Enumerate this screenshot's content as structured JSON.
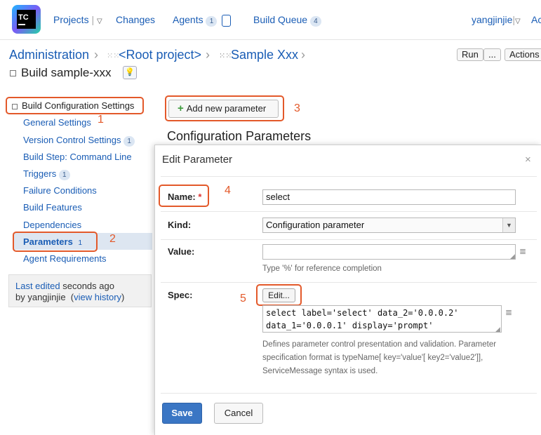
{
  "nav": {
    "logo_text": "TC",
    "projects": "Projects",
    "changes": "Changes",
    "agents": "Agents",
    "agents_count": "1",
    "build_queue": "Build Queue",
    "build_queue_count": "4",
    "user": "yangjinjie",
    "cut_link": "Ac"
  },
  "breadcrumb": {
    "admin": "Administration",
    "root": "<Root project>",
    "project": "Sample Xxx"
  },
  "header": {
    "run": "Run",
    "run_more": "...",
    "actions": "Actions",
    "build_title": "Build sample-xxx"
  },
  "sidebar": {
    "section": "Build Configuration Settings",
    "items": [
      {
        "label": "General Settings",
        "count": ""
      },
      {
        "label": "Version Control Settings",
        "count": "1"
      },
      {
        "label": "Build Step: Command Line",
        "count": ""
      },
      {
        "label": "Triggers",
        "count": "1"
      },
      {
        "label": "Failure Conditions",
        "count": ""
      },
      {
        "label": "Build Features",
        "count": ""
      },
      {
        "label": "Dependencies",
        "count": ""
      },
      {
        "label": "Parameters",
        "count": "1"
      },
      {
        "label": "Agent Requirements",
        "count": ""
      }
    ],
    "last_edited": "Last edited",
    "last_edited_when": "seconds ago",
    "by_user": "by yangjinjie",
    "view_history": "view history"
  },
  "main": {
    "add_param": "Add new parameter",
    "section_title": "Configuration Parameters"
  },
  "dialog": {
    "title": "Edit Parameter",
    "close": "×",
    "name_label": "Name:",
    "required_mark": "*",
    "name_value": "select",
    "kind_label": "Kind:",
    "kind_value": "Configuration parameter",
    "value_label": "Value:",
    "value_value": "",
    "value_hint": "Type '%' for reference completion",
    "spec_label": "Spec:",
    "spec_edit": "Edit...",
    "spec_line1": "select label='select' data_2='0.0.0.2'",
    "spec_line2": "data_1='0.0.0.1' display='prompt'",
    "spec_hint1": "Defines parameter control presentation and validation. Parameter",
    "spec_hint2": "specification format is typeName[ key='value'[ key2='value2']],",
    "spec_hint3": "ServiceMessage syntax is used.",
    "save": "Save",
    "cancel": "Cancel"
  },
  "annotations": [
    "1",
    "2",
    "3",
    "4",
    "5"
  ],
  "colors": {
    "link": "#1a5db5",
    "annotation": "#e3592a",
    "save_button": "#3a76c4"
  }
}
